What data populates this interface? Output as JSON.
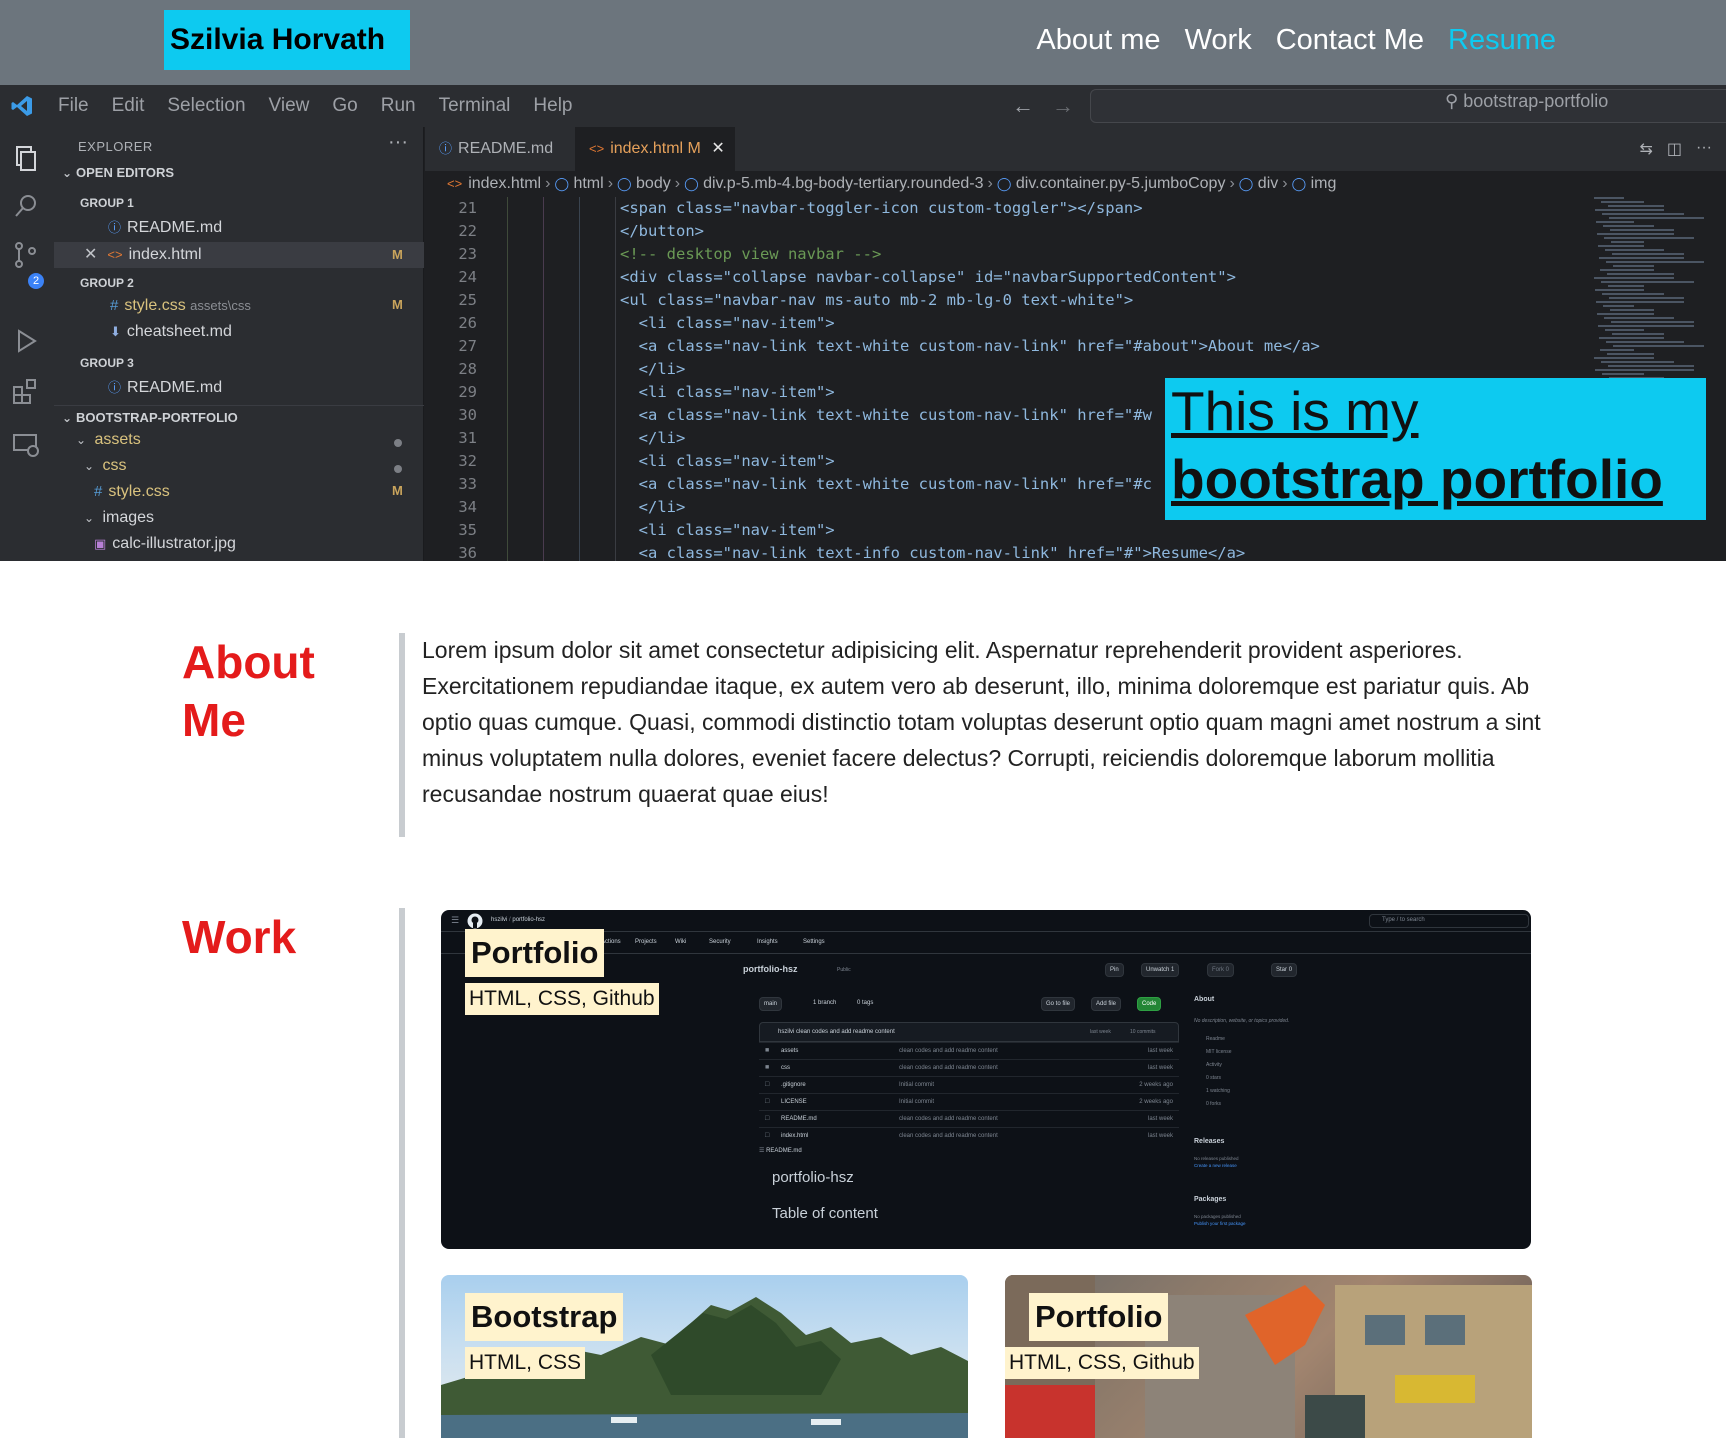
{
  "navbar": {
    "brand": "Szilvia Horvath",
    "links": [
      "About me",
      "Work",
      "Contact Me",
      "Resume"
    ]
  },
  "hero": {
    "title_line1": "This is my",
    "title_line2": "bootstrap portfolio",
    "vscode": {
      "menu": [
        "File",
        "Edit",
        "Selection",
        "View",
        "Go",
        "Run",
        "Terminal",
        "Help"
      ],
      "search": "bootstrap-portfolio",
      "explorer_title": "EXPLORER",
      "sidebar": {
        "open_editors": "OPEN EDITORS",
        "group1": "GROUP 1",
        "g1_readme": "README.md",
        "g1_index": "index.html",
        "group2": "GROUP 2",
        "g2_style": "style.css",
        "g2_style_path": "assets\\css",
        "g2_cheatsheet": "cheatsheet.md",
        "group3": "GROUP 3",
        "g3_readme": "README.md",
        "project": "BOOTSTRAP-PORTFOLIO",
        "assets": "assets",
        "css": "css",
        "stylecss": "style.css",
        "images": "images",
        "calc": "calc-illustrator.jpg",
        "modified": "M"
      },
      "tabs": [
        "README.md",
        "index.html M"
      ],
      "breadcrumb": [
        "index.html",
        "html",
        "body",
        "div.p-5.mb-4.bg-body-tertiary.rounded-3",
        "div.container.py-5.jumboCopy",
        "div",
        "img"
      ],
      "code": [
        {
          "n": "21",
          "t": "<span class=\"navbar-toggler-icon custom-toggler\"></span>"
        },
        {
          "n": "22",
          "t": "</button>"
        },
        {
          "n": "23",
          "t": "<!-- desktop view navbar -->"
        },
        {
          "n": "24",
          "t": "<div class=\"collapse navbar-collapse\" id=\"navbarSupportedContent\">"
        },
        {
          "n": "25",
          "t": "<ul class=\"navbar-nav ms-auto mb-2 mb-lg-0 text-white\">"
        },
        {
          "n": "26",
          "t": "  <li class=\"nav-item\">"
        },
        {
          "n": "27",
          "t": "  <a class=\"nav-link text-white custom-nav-link\" href=\"#about\">About me</a>"
        },
        {
          "n": "28",
          "t": "  </li>"
        },
        {
          "n": "29",
          "t": "  <li class=\"nav-item\">"
        },
        {
          "n": "30",
          "t": "  <a class=\"nav-link text-white custom-nav-link\" href=\"#w"
        },
        {
          "n": "31",
          "t": "  </li>"
        },
        {
          "n": "32",
          "t": "  <li class=\"nav-item\">"
        },
        {
          "n": "33",
          "t": "  <a class=\"nav-link text-white custom-nav-link\" href=\"#c"
        },
        {
          "n": "34",
          "t": "  </li>"
        },
        {
          "n": "35",
          "t": "  <li class=\"nav-item\">"
        },
        {
          "n": "36",
          "t": "  <a class=\"nav-link text-info custom-nav-link\" href=\"#\">Resume</a>"
        }
      ]
    }
  },
  "about": {
    "title": "About Me",
    "text": "Lorem ipsum dolor sit amet consectetur adipisicing elit. Aspernatur reprehenderit provident asperiores. Exercitationem repudiandae itaque, ex autem vero ab deserunt, illo, minima doloremque est pariatur quis. Ab optio quas cumque. Quasi, commodi distinctio totam voluptas deserunt optio quam magni amet nostrum a sint minus voluptatem nulla dolores, eveniet facere delectus? Corrupti, reiciendis doloremque laborum mollitia recusandae nostrum quaerat quae eius!"
  },
  "work": {
    "title": "Work",
    "cards": [
      {
        "title": "Portfolio",
        "tech": "HTML, CSS, Github"
      },
      {
        "title": "Bootstrap",
        "tech": "HTML, CSS"
      },
      {
        "title": "Portfolio",
        "tech": "HTML, CSS, Github"
      }
    ],
    "github": {
      "path_user": "hszilvi",
      "path_sep": "/",
      "path_repo": "portfolio-hsz",
      "tabs": [
        "Actions",
        "Projects",
        "Wiki",
        "Security",
        "Insights",
        "Settings"
      ],
      "search": "Type / to search",
      "repo": "portfolio-hsz",
      "visibility": "Public",
      "pin": "Pin",
      "unwatch": "Unwatch",
      "unwatch_count": "1",
      "fork": "Fork",
      "fork_count": "0",
      "star": "Star",
      "star_count": "0",
      "branch": "main",
      "branches": "1 branch",
      "tags": "0 tags",
      "goto": "Go to file",
      "addfile": "Add file",
      "codebtn": "Code",
      "commit_msg": "hszilvi clean codes and add readme content",
      "commit_meta": "last week",
      "commits": "10 commits",
      "files": [
        {
          "name": "assets",
          "msg": "clean codes and add readme content",
          "time": "last week"
        },
        {
          "name": "css",
          "msg": "clean codes and add readme content",
          "time": "last week"
        },
        {
          "name": ".gitignore",
          "msg": "Initial commit",
          "time": "2 weeks ago"
        },
        {
          "name": "LICENSE",
          "msg": "Initial commit",
          "time": "2 weeks ago"
        },
        {
          "name": "README.md",
          "msg": "clean codes and add readme content",
          "time": "last week"
        },
        {
          "name": "index.html",
          "msg": "clean codes and add readme content",
          "time": "last week"
        }
      ],
      "readme_label": "README.md",
      "readme_title": "portfolio-hsz",
      "readme_toc": "Table of content",
      "about_h": "About",
      "about_desc": "No description, website, or topics provided.",
      "about_items": [
        "Readme",
        "MIT license",
        "Activity",
        "0 stars",
        "1 watching",
        "0 forks"
      ],
      "releases_h": "Releases",
      "releases_desc": "No releases published",
      "releases_link": "Create a new release",
      "packages_h": "Packages",
      "packages_desc": "No packages published",
      "packages_link": "Publish your first package"
    }
  },
  "colors": {
    "navbar_bg": "#6c757d",
    "brand_bg": "#0dcaf0",
    "resume_link": "#0dcaf0",
    "section_title": "#e41b1b",
    "card_label_bg": "#fff3cd"
  }
}
